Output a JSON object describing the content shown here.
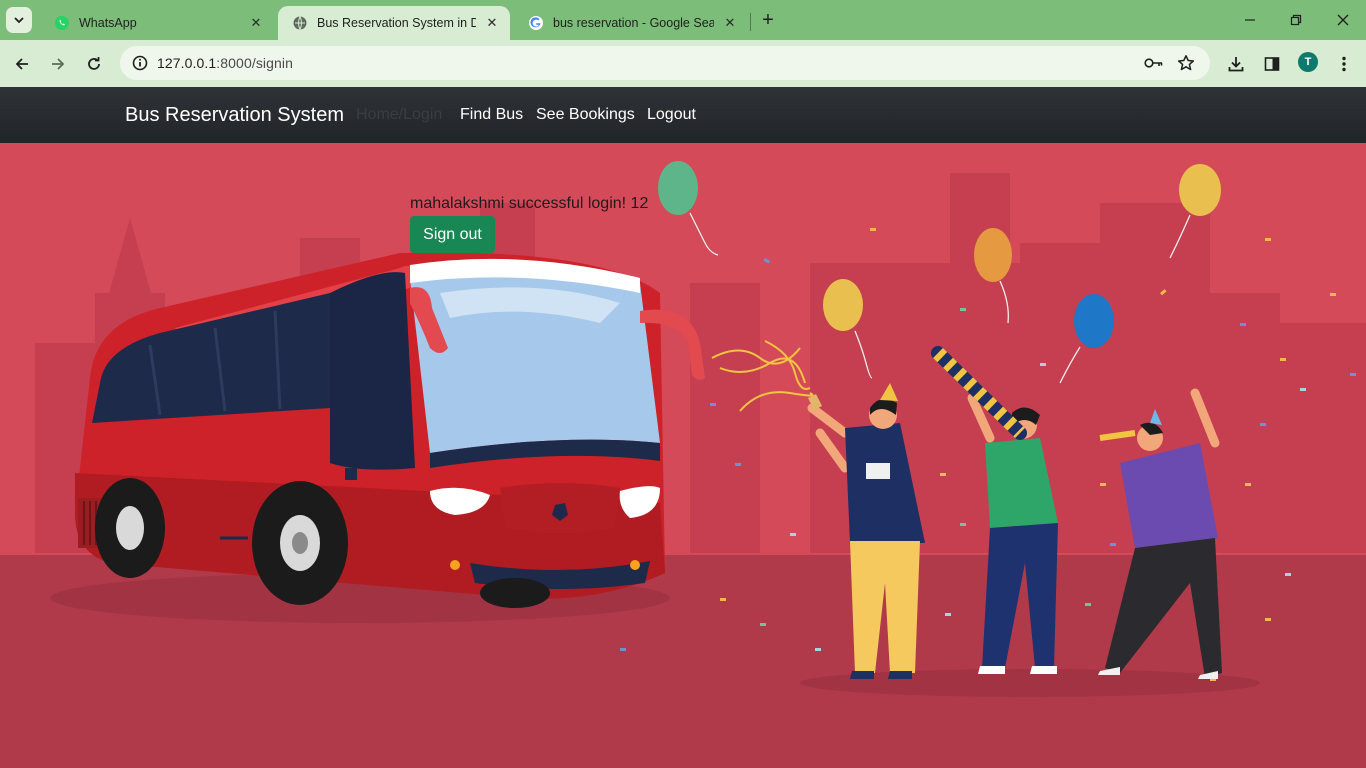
{
  "browser": {
    "tabs": [
      {
        "title": "WhatsApp",
        "icon": "whatsapp-icon"
      },
      {
        "title": "Bus Reservation System in Djan",
        "icon": "globe-icon",
        "active": true
      },
      {
        "title": "bus reservation - Google Searc",
        "icon": "google-icon"
      }
    ],
    "address": {
      "host": "127.0.0.1",
      "path": ":8000/signin"
    },
    "profile_initial": "T"
  },
  "navbar": {
    "brand": "Bus Reservation System",
    "links": [
      "Home/Login",
      "Find Bus",
      "See Bookings",
      "Logout"
    ]
  },
  "main": {
    "message": "mahalakshmi successful login! 12",
    "signout_label": "Sign out"
  },
  "colors": {
    "tabbar": "#7dbd7a",
    "toolbar": "#d7ecd2",
    "navbar": "#212529",
    "hero": "#d64b59",
    "signout": "#198754"
  }
}
